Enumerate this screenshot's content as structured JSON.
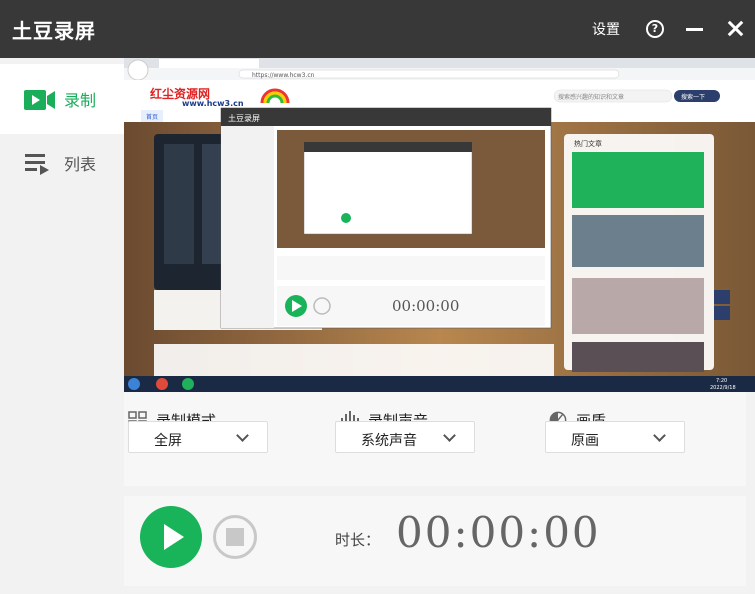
{
  "app": {
    "title": "土豆录屏",
    "settings_label": "设置",
    "help_icon": "question-circle-icon",
    "minimize_icon": "minimize-icon",
    "close_icon": "close-icon"
  },
  "sidebar": {
    "items": [
      {
        "label": "录制",
        "icon": "video-camera-icon",
        "active": true,
        "color": "#1aad5a"
      },
      {
        "label": "列表",
        "icon": "list-play-icon",
        "active": false
      }
    ]
  },
  "preview": {
    "browser_url": "https://www.hcw3.cn",
    "site_name": "红尘资源网",
    "site_domain": "www.hcw3.cn",
    "search_placeholder": "搜索感兴趣的知识和文章",
    "search_button": "搜索一下",
    "nav_home": "首页",
    "sidebar_title": "热门文章",
    "inner_app_title": "土豆录屏",
    "taskbar_time": "7:20",
    "taskbar_date": "2022/9/18"
  },
  "settings": {
    "mode": {
      "label": "录制模式",
      "value": "全屏",
      "icon": "grid-icon"
    },
    "audio": {
      "label": "录制声音",
      "value": "系统声音",
      "icon": "sound-wave-icon"
    },
    "quality": {
      "label": "画质",
      "value": "原画",
      "icon": "quality-half-circle-icon"
    }
  },
  "controls": {
    "duration_label": "时长：",
    "duration_value": "00:00:00",
    "accent_color": "#19b35a"
  }
}
